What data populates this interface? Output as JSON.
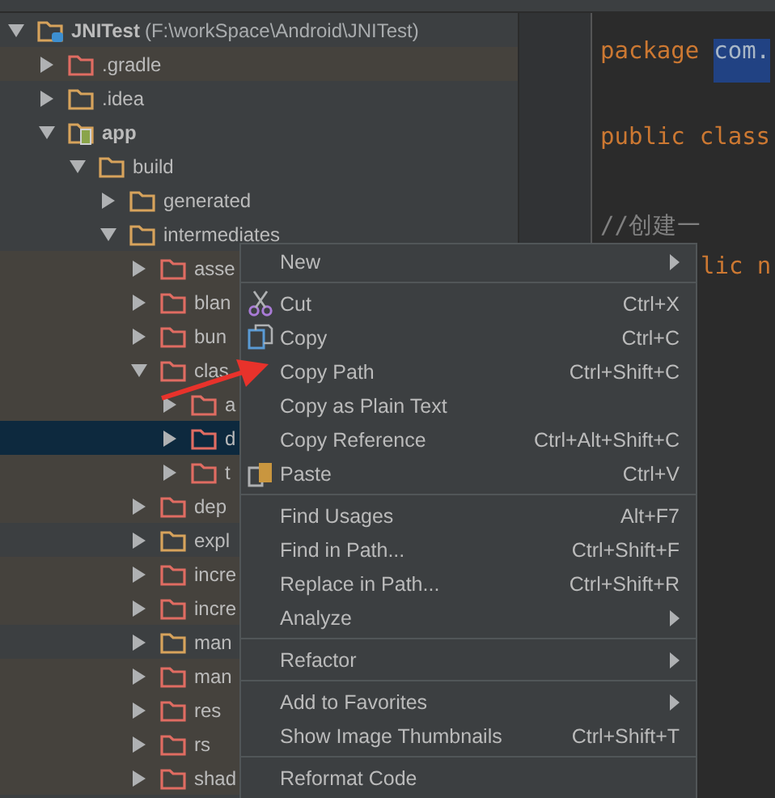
{
  "tree": [
    {
      "kind": "project",
      "label": "JNITest",
      "path": "(F:\\workSpace\\Android\\JNITest)",
      "expanded": true,
      "selected": false,
      "children": [
        {
          "kind": "folder",
          "label": ".gradle",
          "expanded": false,
          "excluded": true,
          "selected": false
        },
        {
          "kind": "folder",
          "label": ".idea",
          "expanded": false,
          "excluded": false,
          "selected": false
        },
        {
          "kind": "module",
          "label": "app",
          "expanded": true,
          "excluded": false,
          "selected": false,
          "children": [
            {
              "kind": "folder",
              "label": "build",
              "expanded": true,
              "excluded": false,
              "selected": false,
              "children": [
                {
                  "kind": "folder",
                  "label": "generated",
                  "expanded": false,
                  "excluded": false,
                  "selected": false
                },
                {
                  "kind": "folder",
                  "label": "intermediates",
                  "expanded": true,
                  "excluded": false,
                  "selected": false,
                  "children": [
                    {
                      "kind": "folder",
                      "label": "asse",
                      "expanded": false,
                      "excluded": true,
                      "selected": false
                    },
                    {
                      "kind": "folder",
                      "label": "blan",
                      "expanded": false,
                      "excluded": true,
                      "selected": false
                    },
                    {
                      "kind": "folder",
                      "label": "bun",
                      "expanded": false,
                      "excluded": true,
                      "selected": false
                    },
                    {
                      "kind": "folder",
                      "label": "clas",
                      "expanded": true,
                      "excluded": true,
                      "selected": false,
                      "children": [
                        {
                          "kind": "folder",
                          "label": "a",
                          "expanded": false,
                          "excluded": true,
                          "selected": false
                        },
                        {
                          "kind": "folder",
                          "label": "d",
                          "expanded": false,
                          "excluded": true,
                          "selected": true
                        },
                        {
                          "kind": "folder",
                          "label": "t",
                          "expanded": false,
                          "excluded": true,
                          "selected": false
                        }
                      ]
                    },
                    {
                      "kind": "folder",
                      "label": "dep",
                      "expanded": false,
                      "excluded": true,
                      "selected": false
                    },
                    {
                      "kind": "folder",
                      "label": "expl",
                      "expanded": false,
                      "excluded": false,
                      "selected": false
                    },
                    {
                      "kind": "folder",
                      "label": "incre",
                      "expanded": false,
                      "excluded": true,
                      "selected": false
                    },
                    {
                      "kind": "folder",
                      "label": "incre",
                      "expanded": false,
                      "excluded": true,
                      "selected": false
                    },
                    {
                      "kind": "folder",
                      "label": "man",
                      "expanded": false,
                      "excluded": false,
                      "selected": false
                    },
                    {
                      "kind": "folder",
                      "label": "man",
                      "expanded": false,
                      "excluded": true,
                      "selected": false
                    },
                    {
                      "kind": "folder",
                      "label": "res",
                      "expanded": false,
                      "excluded": true,
                      "selected": false
                    },
                    {
                      "kind": "folder",
                      "label": "rs",
                      "expanded": false,
                      "excluded": true,
                      "selected": false
                    },
                    {
                      "kind": "folder",
                      "label": "shad",
                      "expanded": false,
                      "excluded": true,
                      "selected": false
                    }
                  ]
                }
              ]
            }
          ]
        }
      ]
    }
  ],
  "editor": {
    "lines": [
      {
        "kind": "code",
        "tokens": [
          {
            "text": "package",
            "kind": "keyword"
          },
          {
            "text": "com.",
            "kind": "selection"
          }
        ]
      },
      {
        "kind": "blank"
      },
      {
        "kind": "code",
        "tokens": [
          {
            "text": "public",
            "kind": "keyword"
          },
          {
            "text": "class",
            "kind": "keyword"
          }
        ]
      },
      {
        "kind": "blank"
      },
      {
        "kind": "code",
        "tokens": [
          {
            "text": "//创建一",
            "kind": "comment"
          }
        ]
      },
      {
        "kind": "code",
        "tokens": [
          {
            "text": "lic n",
            "kind": "keyword"
          }
        ]
      }
    ]
  },
  "context_menu": [
    {
      "kind": "item",
      "label": "New",
      "submenu": true
    },
    {
      "kind": "separator"
    },
    {
      "kind": "cut",
      "label": "Cut",
      "shortcut": "Ctrl+X"
    },
    {
      "kind": "copy",
      "label": "Copy",
      "shortcut": "Ctrl+C"
    },
    {
      "kind": "item",
      "label": "Copy Path",
      "shortcut": "Ctrl+Shift+C"
    },
    {
      "kind": "item",
      "label": "Copy as Plain Text"
    },
    {
      "kind": "item",
      "label": "Copy Reference",
      "shortcut": "Ctrl+Alt+Shift+C"
    },
    {
      "kind": "paste",
      "label": "Paste",
      "shortcut": "Ctrl+V"
    },
    {
      "kind": "separator"
    },
    {
      "kind": "item",
      "label": "Find Usages",
      "shortcut": "Alt+F7"
    },
    {
      "kind": "item",
      "label": "Find in Path...",
      "shortcut": "Ctrl+Shift+F"
    },
    {
      "kind": "item",
      "label": "Replace in Path...",
      "shortcut": "Ctrl+Shift+R"
    },
    {
      "kind": "item",
      "label": "Analyze",
      "submenu": true
    },
    {
      "kind": "separator"
    },
    {
      "kind": "item",
      "label": "Refactor",
      "submenu": true
    },
    {
      "kind": "separator"
    },
    {
      "kind": "item",
      "label": "Add to Favorites",
      "submenu": true
    },
    {
      "kind": "item",
      "label": "Show Image Thumbnails",
      "shortcut": "Ctrl+Shift+T"
    },
    {
      "kind": "separator"
    },
    {
      "kind": "item",
      "label": "Reformat Code"
    }
  ]
}
